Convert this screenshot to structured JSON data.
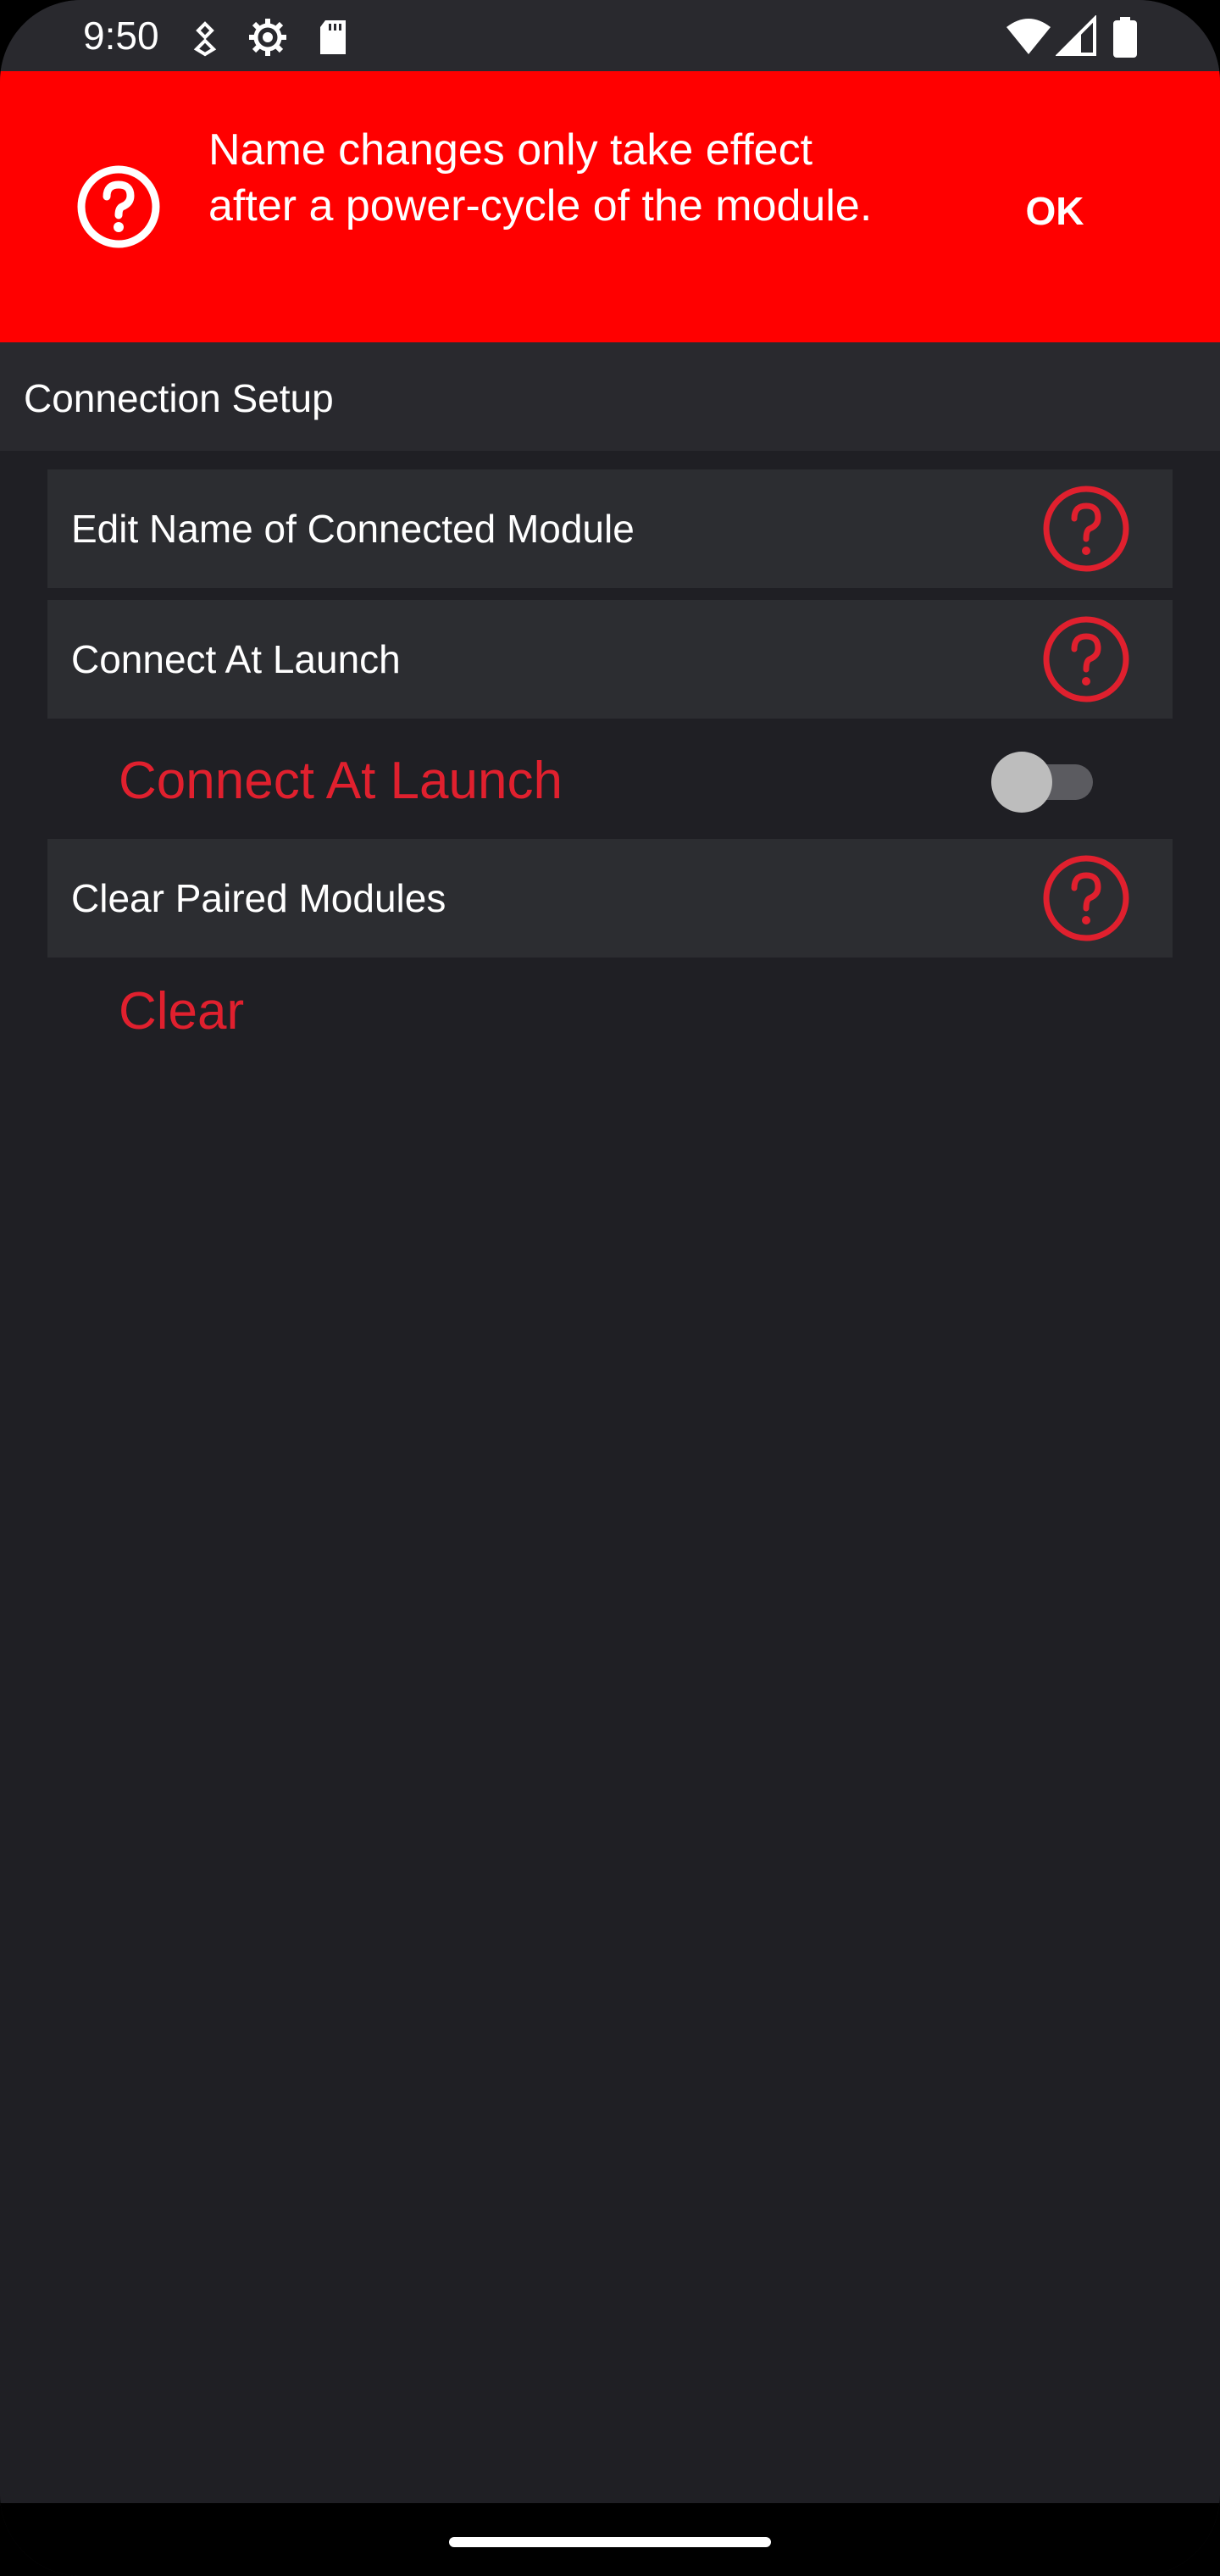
{
  "status_bar": {
    "time": "9:50",
    "left_icons": [
      "notification-icon",
      "settings-gear-icon",
      "sd-card-icon"
    ],
    "right_icons": [
      "wifi-icon",
      "cell-signal-icon",
      "battery-icon"
    ]
  },
  "banner": {
    "message": "Name changes only take effect after a power-cycle of the module.",
    "action_label": "OK",
    "icon": "help-circle-icon",
    "background_color": "#ff0000"
  },
  "section": {
    "title": "Connection Setup"
  },
  "settings": {
    "edit_name": {
      "label": "Edit Name of Connected Module",
      "help_icon": "help-circle-icon"
    },
    "connect_at_launch": {
      "label": "Connect At Launch",
      "help_icon": "help-circle-icon",
      "toggle_label": "Connect At Launch",
      "toggle_on": false
    },
    "clear_paired": {
      "label": "Clear Paired Modules",
      "help_icon": "help-circle-icon",
      "action_label": "Clear"
    }
  },
  "colors": {
    "accent": "#e0202e",
    "background": "#1f1f24",
    "card": "#2c2d31"
  }
}
